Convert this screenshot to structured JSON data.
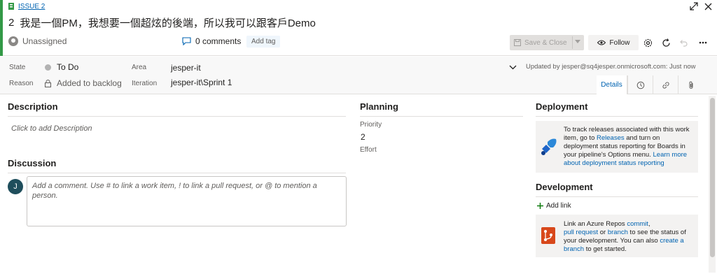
{
  "header": {
    "type_label": "ISSUE 2",
    "id": "2",
    "title": "我是一個PM，我想要一個超炫的後端，所以我可以跟客戶Demo",
    "assigned": "Unassigned",
    "comments": "0 comments",
    "add_tag": "Add tag",
    "save_close": "Save & Close",
    "follow": "Follow"
  },
  "fields": {
    "state_label": "State",
    "state_value": "To Do",
    "reason_label": "Reason",
    "reason_value": "Added to backlog",
    "area_label": "Area",
    "area_value": "jesper-it",
    "iteration_label": "Iteration",
    "iteration_value": "jesper-it\\Sprint 1",
    "updated": "Updated by jesper@sq4jesper.onmicrosoft.com: Just now"
  },
  "tabs": {
    "details": "Details"
  },
  "left": {
    "description_title": "Description",
    "description_placeholder": "Click to add Description",
    "discussion_title": "Discussion",
    "avatar_initial": "J",
    "comment_placeholder": "Add a comment. Use # to link a work item, ! to link a pull request, or @ to mention a person."
  },
  "planning": {
    "title": "Planning",
    "priority_label": "Priority",
    "priority_value": "2",
    "effort_label": "Effort"
  },
  "deployment": {
    "title": "Deployment",
    "text_1": "To track releases associated with this work item, go to ",
    "releases_link": "Releases",
    "text_2": " and turn on deployment status reporting for Boards in your pipeline's Options menu. ",
    "learn_link": "Learn more about deployment status reporting"
  },
  "development": {
    "title": "Development",
    "add_link": "Add link",
    "text_1": "Link an Azure Repos ",
    "commit_link": "commit",
    "text_2": ",",
    "pr_link": "pull request",
    "text_3": " or ",
    "branch_link": "branch",
    "text_4": " to see the status of your development. You can also ",
    "create_branch_link": "create a branch",
    "text_5": " to get started."
  },
  "colors": {
    "accent": "#339947",
    "link": "#0063b1",
    "tag_bg": "#eff6fc"
  }
}
